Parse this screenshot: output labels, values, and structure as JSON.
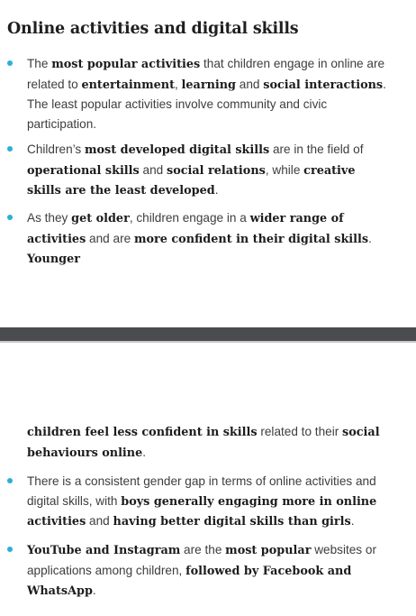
{
  "title": "Online activities and digital skills",
  "bullets": [
    {
      "segments": [
        {
          "t": "The ",
          "b": false
        },
        {
          "t": "most popular activities",
          "b": true
        },
        {
          "t": " that children engage in online are related to ",
          "b": false
        },
        {
          "t": "entertainment",
          "b": true
        },
        {
          "t": ", ",
          "b": false
        },
        {
          "t": "learning",
          "b": true
        },
        {
          "t": " and ",
          "b": false
        },
        {
          "t": "social interactions",
          "b": true
        },
        {
          "t": ". The least popular activities involve community and civic participation.",
          "b": false
        }
      ]
    },
    {
      "segments": [
        {
          "t": "Children’s ",
          "b": false
        },
        {
          "t": "most developed digital skills",
          "b": true
        },
        {
          "t": " are in the field of ",
          "b": false
        },
        {
          "t": "operational skills",
          "b": true
        },
        {
          "t": " and ",
          "b": false
        },
        {
          "t": "social relations",
          "b": true
        },
        {
          "t": ", while ",
          "b": false
        },
        {
          "t": "creative skills are the least developed",
          "b": true
        },
        {
          "t": ".",
          "b": false
        }
      ]
    },
    {
      "segments": [
        {
          "t": "As they ",
          "b": false
        },
        {
          "t": "get older",
          "b": true
        },
        {
          "t": ", children engage in a ",
          "b": false
        },
        {
          "t": "wider range of activities",
          "b": true
        },
        {
          "t": " and are ",
          "b": false
        },
        {
          "t": "more confident in their digital skills",
          "b": true
        },
        {
          "t": ". ",
          "b": false
        },
        {
          "t": "Younger",
          "b": true
        }
      ]
    },
    {
      "segments": [
        {
          "t": "children feel less confident in skills",
          "b": true
        },
        {
          "t": " related to their ",
          "b": false
        },
        {
          "t": "social behaviours online",
          "b": true
        },
        {
          "t": ".",
          "b": false
        }
      ]
    },
    {
      "segments": [
        {
          "t": "There is a consistent gender gap in terms of online activities and digital skills, with ",
          "b": false
        },
        {
          "t": "boys generally engaging more in online activities",
          "b": true
        },
        {
          "t": " and ",
          "b": false
        },
        {
          "t": "having better digital skills than girls",
          "b": true
        },
        {
          "t": ".",
          "b": false
        }
      ]
    },
    {
      "segments": [
        {
          "t": "YouTube and Instagram",
          "b": true
        },
        {
          "t": " are the ",
          "b": false
        },
        {
          "t": "most popular",
          "b": true
        },
        {
          "t": " websites or applications among children, ",
          "b": false
        },
        {
          "t": "followed by Facebook and WhatsApp",
          "b": true
        },
        {
          "t": ".",
          "b": false
        }
      ]
    }
  ],
  "colors": {
    "bullet": "#2ab0d6",
    "page_break": "#4a4c4f"
  }
}
